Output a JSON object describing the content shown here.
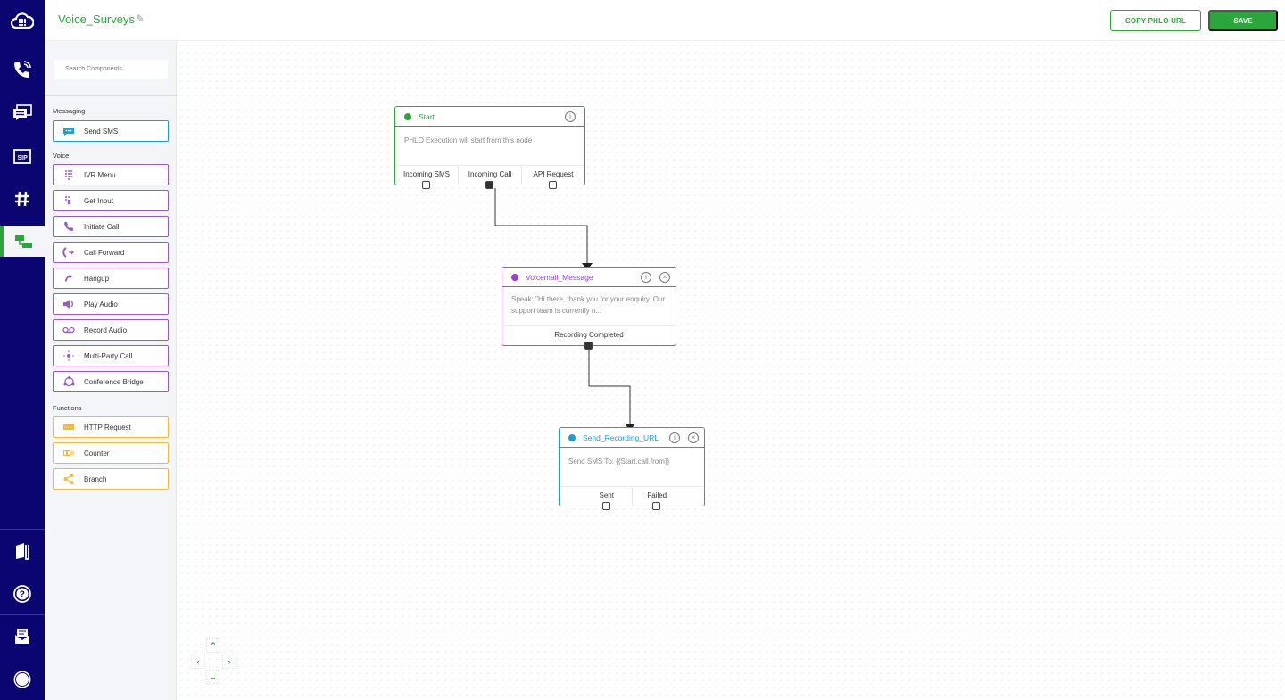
{
  "app": {
    "flow_title": "Voice_Surveys"
  },
  "header": {
    "copy_url_label": "COPY PHLO URL",
    "save_label": "SAVE"
  },
  "rail": {
    "items": [
      {
        "icon": "cloud-grid-logo-icon"
      },
      {
        "icon": "voice-calls-icon"
      },
      {
        "icon": "messaging-icon"
      },
      {
        "icon": "sip-icon"
      },
      {
        "icon": "numbers-hash-icon"
      },
      {
        "icon": "phlo-flow-icon",
        "active": true
      },
      {
        "icon": "docs-book-icon"
      },
      {
        "icon": "help-icon"
      },
      {
        "icon": "support-mail-icon"
      },
      {
        "icon": "account-circle-icon"
      }
    ]
  },
  "palette": {
    "search_placeholder": "Search Components",
    "sections": [
      {
        "title": "Messaging",
        "items": [
          "Send SMS"
        ]
      },
      {
        "title": "Voice",
        "items": [
          "IVR Menu",
          "Get Input",
          "Initiate Call",
          "Call Forward",
          "Hangup",
          "Play Audio",
          "Record Audio",
          "Multi-Party Call",
          "Conference Bridge"
        ]
      },
      {
        "title": "Functions",
        "items": [
          "HTTP Request",
          "Counter",
          "Branch"
        ]
      }
    ]
  },
  "nodes": {
    "start": {
      "title": "Start",
      "color": "#2aa63b",
      "body": "PHLO Execution will start from this node",
      "ports": [
        "Incoming SMS",
        "Incoming Call",
        "API Request"
      ]
    },
    "voicemail": {
      "title": "Voicemail_Message",
      "color": "#9b3fd0",
      "body": "Speak: \"Hi there, thank you for your enquiry. Our support team is currently n...",
      "ports": [
        "Recording Completed"
      ]
    },
    "send_sms": {
      "title": "Send_Recording_URL",
      "color": "#1a9ed6",
      "body": "Send SMS To: {{Start.call.from}}",
      "ports": [
        "Sent",
        "Failed"
      ]
    }
  },
  "colors": {
    "accent": "#2aa63b",
    "rail": "#0a0570",
    "voice": "#9b59c8",
    "messaging": "#1a9ed6",
    "functions": "#f3b935"
  }
}
